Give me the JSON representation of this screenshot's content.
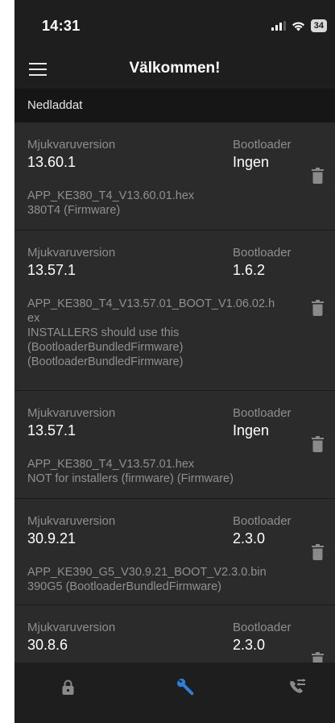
{
  "status_bar": {
    "time": "14:31",
    "battery": "34",
    "icons": [
      "signal-icon",
      "wifi-icon",
      "battery-icon"
    ]
  },
  "app_bar": {
    "title": "Välkommen!",
    "menu_icon": "menu-icon"
  },
  "section": {
    "title": "Nedladdat"
  },
  "labels": {
    "software_version": "Mjukvaruversion",
    "bootloader": "Bootloader"
  },
  "items": [
    {
      "software_version": "13.60.1",
      "bootloader": "Ingen",
      "lines": [
        "APP_KE380_T4_V13.60.01.hex",
        "380T4 (Firmware)"
      ]
    },
    {
      "software_version": "13.57.1",
      "bootloader": "1.6.2",
      "lines": [
        "APP_KE380_T4_V13.57.01_BOOT_V1.06.02.h",
        "ex",
        "INSTALLERS should use this",
        "(BootloaderBundledFirmware)",
        "(BootloaderBundledFirmware)"
      ]
    },
    {
      "software_version": "13.57.1",
      "bootloader": "Ingen",
      "lines": [
        "APP_KE380_T4_V13.57.01.hex",
        "NOT for installers (firmware) (Firmware)"
      ]
    },
    {
      "software_version": "30.9.21",
      "bootloader": "2.3.0",
      "lines": [
        "APP_KE390_G5_V30.9.21_BOOT_V2.3.0.bin",
        "390G5 (BootloaderBundledFirmware)"
      ]
    },
    {
      "software_version": "30.8.6",
      "bootloader": "2.3.0",
      "lines": []
    }
  ],
  "bottom_nav": {
    "tabs": [
      {
        "icon": "lock-icon",
        "active": false
      },
      {
        "icon": "wrench-icon",
        "active": true
      },
      {
        "icon": "phone-transfer-icon",
        "active": false
      }
    ]
  },
  "colors": {
    "background": "#1e1e1e",
    "card": "#2b2b2b",
    "accent": "#2f7fd6",
    "muted_text": "#8e8e8e"
  }
}
